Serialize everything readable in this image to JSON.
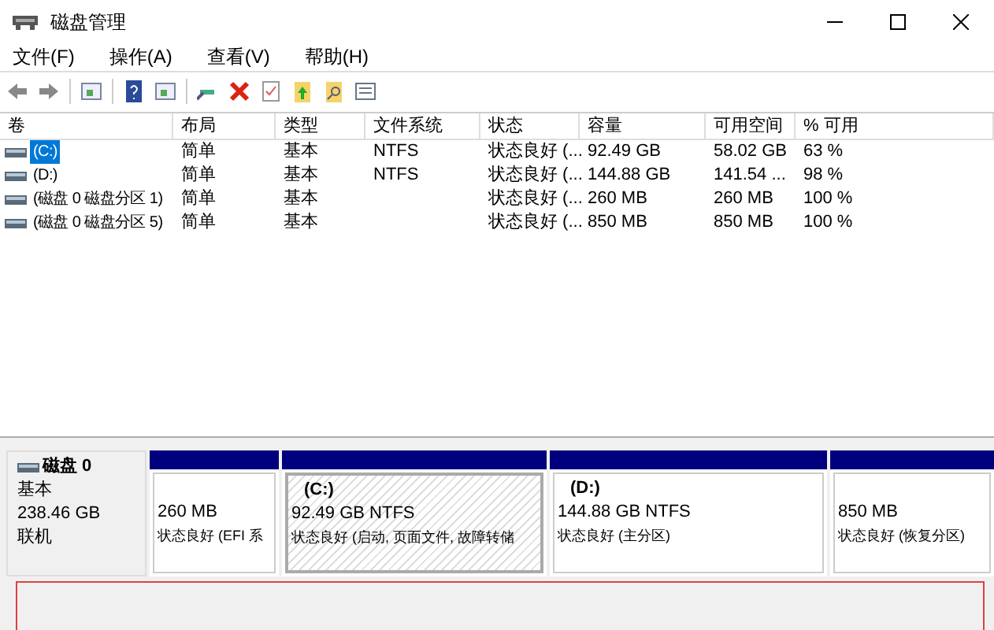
{
  "window": {
    "title": "磁盘管理"
  },
  "menu": [
    "文件(F)",
    "操作(A)",
    "查看(V)",
    "帮助(H)"
  ],
  "table": {
    "columns": [
      "卷",
      "布局",
      "类型",
      "文件系统",
      "状态",
      "容量",
      "可用空间",
      "% 可用"
    ],
    "rows": [
      {
        "selected": true,
        "cells": [
          "(C:)",
          "简单",
          "基本",
          "NTFS",
          "状态良好 (...",
          "92.49 GB",
          "58.02 GB",
          "63 %"
        ]
      },
      {
        "selected": false,
        "cells": [
          "(D:)",
          "简单",
          "基本",
          "NTFS",
          "状态良好 (...",
          "144.88 GB",
          "141.54 ...",
          "98 %"
        ]
      },
      {
        "selected": false,
        "cells": [
          "(磁盘 0 磁盘分区 1)",
          "简单",
          "基本",
          "",
          "状态良好 (...",
          "260 MB",
          "260 MB",
          "100 %"
        ]
      },
      {
        "selected": false,
        "cells": [
          "(磁盘 0 磁盘分区 5)",
          "简单",
          "基本",
          "",
          "状态良好 (...",
          "850 MB",
          "850 MB",
          "100 %"
        ]
      }
    ]
  },
  "disk": {
    "name": "磁盘 0",
    "type": "基本",
    "size": "238.46 GB",
    "status": "联机",
    "partitions": [
      {
        "size": "260 MB",
        "status": "状态良好 (EFI 系",
        "selected": false
      },
      {
        "label": "(C:)",
        "size": "92.49 GB NTFS",
        "status": "状态良好 (启动, 页面文件, 故障转储",
        "selected": true
      },
      {
        "label": "(D:)",
        "size": "144.88 GB NTFS",
        "status": "状态良好 (主分区)",
        "selected": false
      },
      {
        "size": "850 MB",
        "status": "状态良好 (恢复分区)",
        "selected": false
      }
    ]
  }
}
